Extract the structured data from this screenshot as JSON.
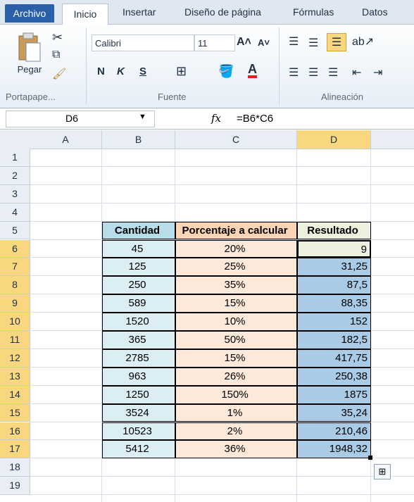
{
  "tabs": {
    "file": "Archivo",
    "home": "Inicio",
    "insert": "Insertar",
    "layout": "Diseño de página",
    "formulas": "Fórmulas",
    "data": "Datos"
  },
  "ribbon": {
    "paste": "Pegar",
    "font_name": "Calibri",
    "font_size": "11",
    "bold": "N",
    "italic": "K",
    "underline": "S",
    "groups": {
      "clipboard": "Portapape...",
      "font": "Fuente",
      "alignment": "Alineación"
    }
  },
  "formula_bar": {
    "name_box": "D6",
    "fx": "fx",
    "formula": "=B6*C6"
  },
  "columns": [
    "A",
    "B",
    "C",
    "D"
  ],
  "rows": [
    "1",
    "2",
    "3",
    "4",
    "5",
    "6",
    "7",
    "8",
    "9",
    "10",
    "11",
    "12",
    "13",
    "14",
    "15",
    "16",
    "17",
    "18",
    "19"
  ],
  "table": {
    "headers": [
      "Cantidad",
      "Porcentaje a calcular",
      "Resultado"
    ],
    "rows": [
      [
        "45",
        "20%",
        "9"
      ],
      [
        "125",
        "25%",
        "31,25"
      ],
      [
        "250",
        "35%",
        "87,5"
      ],
      [
        "589",
        "15%",
        "88,35"
      ],
      [
        "1520",
        "10%",
        "152"
      ],
      [
        "365",
        "50%",
        "182,5"
      ],
      [
        "2785",
        "15%",
        "417,75"
      ],
      [
        "963",
        "26%",
        "250,38"
      ],
      [
        "1250",
        "150%",
        "1875"
      ],
      [
        "3524",
        "1%",
        "35,24"
      ],
      [
        "10523",
        "2%",
        "210,46"
      ],
      [
        "5412",
        "36%",
        "1948,32"
      ]
    ]
  },
  "colors": {
    "qty_fill": "#daeef3",
    "pct_fill": "#fde9d9",
    "result_fill": "#a9cbe6",
    "header_qty": "#b7dde8",
    "header_pct": "#fbd4b4",
    "header_res": "#ebf1de",
    "selected_col": "#f9d77e"
  }
}
